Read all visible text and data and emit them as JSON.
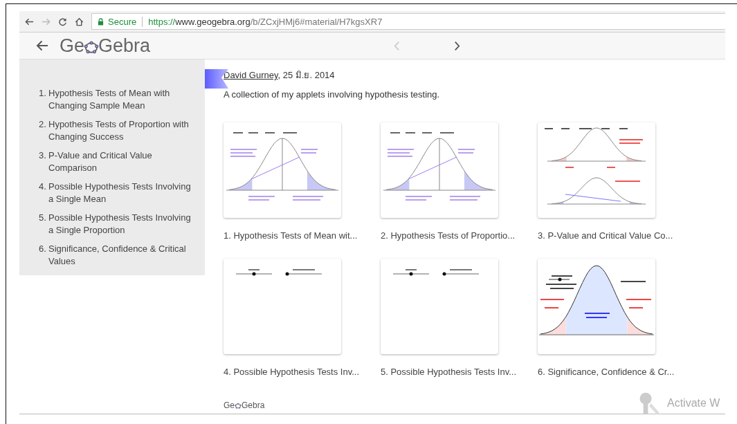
{
  "browser": {
    "secure_label": "Secure",
    "url_scheme": "https://",
    "url_host": "www.geogebra.org",
    "url_path": "/b/ZCxjHMj6#material/H7kgsXR7"
  },
  "header": {
    "logo_before": "Ge",
    "logo_after": "Gebra",
    "prev_disabled": true,
    "next_disabled": false
  },
  "sidebar": {
    "items": [
      {
        "number": "1.",
        "title": "Hypothesis Tests of Mean with Changing Sample Mean"
      },
      {
        "number": "2.",
        "title": "Hypothesis Tests of Proportion with Changing Success"
      },
      {
        "number": "3.",
        "title": "P-Value and Critical Value Comparison"
      },
      {
        "number": "4.",
        "title": "Possible Hypothesis Tests Involving a Single Mean"
      },
      {
        "number": "5.",
        "title": "Possible Hypothesis Tests Involving a Single Proportion"
      },
      {
        "number": "6.",
        "title": "Significance, Confidence & Critical Values"
      }
    ]
  },
  "author": {
    "name": "David Gurney",
    "date": ", 25 มิ.ย. 2014"
  },
  "description": "A collection of my applets involving hypothesis testing.",
  "cards": [
    {
      "kind": "tails",
      "title": "1. Hypothesis Tests of Mean wit..."
    },
    {
      "kind": "tails",
      "title": "2. Hypothesis Tests of Proportio..."
    },
    {
      "kind": "two-curves",
      "title": "3. P-Value and Critical Value Co..."
    },
    {
      "kind": "sliders",
      "title": "4. Possible Hypothesis Tests Inv..."
    },
    {
      "kind": "sliders",
      "title": "5. Possible Hypothesis Tests Inv..."
    },
    {
      "kind": "central",
      "title": "6. Significance, Confidence & Cr..."
    }
  ],
  "footer": {
    "logo_before": "Ge",
    "logo_after": "Gebra"
  },
  "activation": {
    "text": "Activate W"
  }
}
